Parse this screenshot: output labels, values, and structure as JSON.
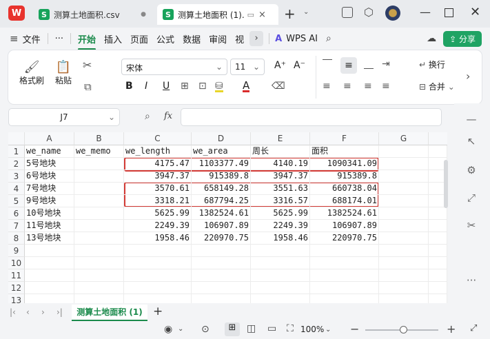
{
  "titlebar": {
    "tabs": [
      {
        "label": "测算土地面积.csv",
        "active": false
      },
      {
        "label": "测算土地面积 (1).",
        "active": true
      }
    ],
    "new_tab": "+",
    "close": "×"
  },
  "menubar": {
    "file": "文件",
    "more": "···",
    "items": [
      "开始",
      "插入",
      "页面",
      "公式",
      "数据",
      "审阅",
      "视"
    ],
    "active": "开始",
    "wps_ai": "WPS AI",
    "share": "分享"
  },
  "ribbon": {
    "format_painter": "格式刷",
    "paste": "粘贴",
    "font_name": "宋体",
    "font_size": "11",
    "wrap": "换行",
    "merge": "合并"
  },
  "formula": {
    "cell_ref": "J7",
    "fx": "fx",
    "value": ""
  },
  "columns": [
    "A",
    "B",
    "C",
    "D",
    "E",
    "F",
    "G"
  ],
  "rows": [
    "1",
    "2",
    "3",
    "4",
    "5",
    "6",
    "7",
    "8",
    "9",
    "10",
    "11",
    "12",
    "13"
  ],
  "headers": [
    "we_name",
    "we_memo",
    "we_length",
    "we_area",
    "周长",
    "面积"
  ],
  "table": [
    [
      "5号地块",
      "",
      "4175.47",
      "1103377.49",
      "4140.19",
      "1090341.09"
    ],
    [
      "6号地块",
      "",
      "3947.37",
      "915389.8",
      "3947.37",
      "915389.8"
    ],
    [
      "7号地块",
      "",
      "3570.61",
      "658149.28",
      "3551.63",
      "660738.04"
    ],
    [
      "9号地块",
      "",
      "3318.21",
      "687794.25",
      "3316.57",
      "688174.01"
    ],
    [
      "10号地块",
      "",
      "5625.99",
      "1382524.61",
      "5625.99",
      "1382524.61"
    ],
    [
      "11号地块",
      "",
      "2249.39",
      "106907.89",
      "2249.39",
      "106907.89"
    ],
    [
      "13号地块",
      "",
      "1958.46",
      "220970.75",
      "1958.46",
      "220970.75"
    ]
  ],
  "sheet": {
    "name": "测算土地面积 (1)",
    "add": "+"
  },
  "status": {
    "zoom": "100%"
  },
  "colors": {
    "accent": "#1a8a4b",
    "highlight_box": "#d33a35",
    "share_button": "#1fa363"
  }
}
